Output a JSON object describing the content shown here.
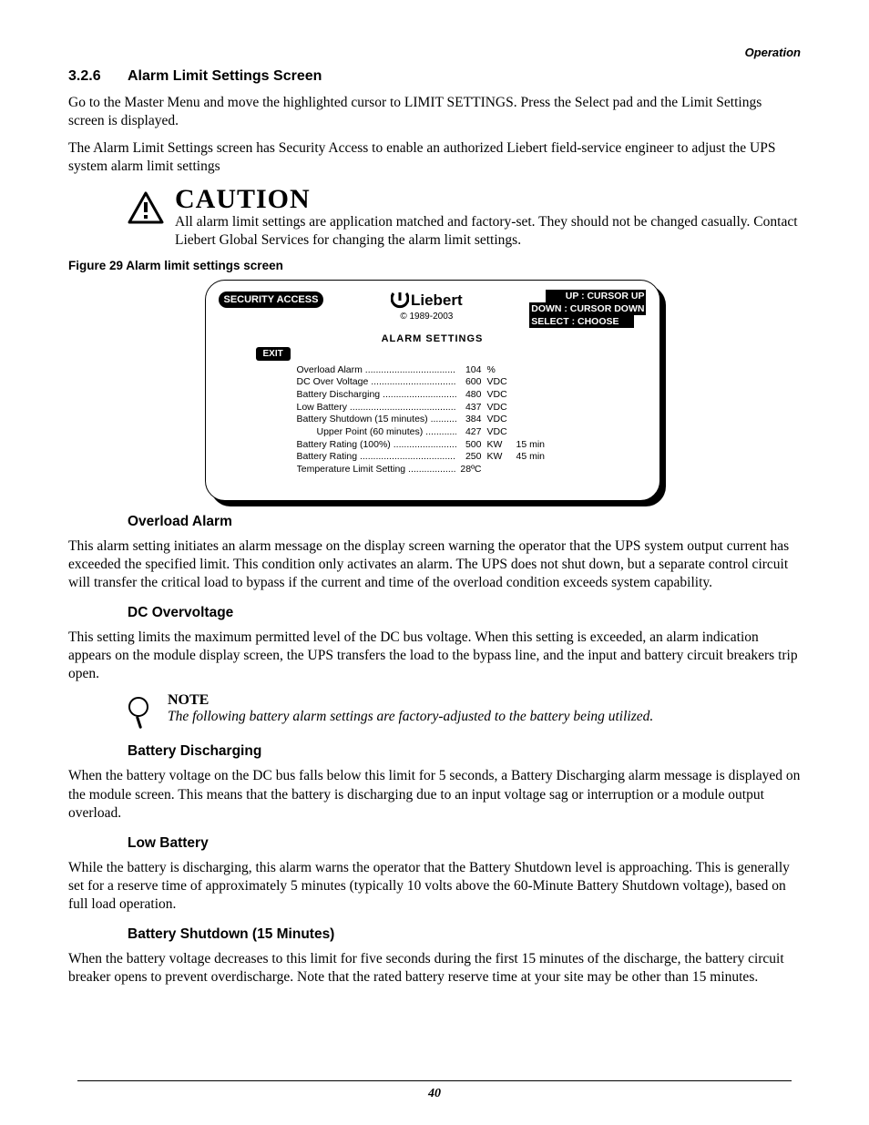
{
  "header": {
    "section": "Operation"
  },
  "section": {
    "number": "3.2.6",
    "title": "Alarm Limit Settings Screen",
    "para1": "Go to the Master Menu and move the highlighted cursor to LIMIT SETTINGS. Press the Select pad and the Limit Settings screen is displayed.",
    "para2": "The Alarm Limit Settings screen has Security Access to enable an authorized Liebert field-service engineer to adjust the UPS system alarm limit settings"
  },
  "caution": {
    "word": "CAUTION",
    "text": "All alarm limit settings are application matched and factory-set. They should not be changed casually. Contact Liebert Global Services for changing the alarm limit settings."
  },
  "figure": {
    "caption": "Figure 29  Alarm limit settings screen"
  },
  "screen": {
    "security_access": "SECURITY ACCESS",
    "brand": "Liebert",
    "copyright": "© 1989-2003",
    "cursor_up": "UP      : CURSOR UP",
    "cursor_down": "DOWN : CURSOR DOWN",
    "select": "SELECT : CHOOSE",
    "title": "ALARM  SETTINGS",
    "exit": "EXIT",
    "rows": [
      {
        "label": "Overload Alarm",
        "value": "104",
        "unit": "%",
        "extra": "",
        "indent": false
      },
      {
        "label": "DC Over Voltage",
        "value": "600",
        "unit": "VDC",
        "extra": "",
        "indent": false
      },
      {
        "label": "Battery Discharging",
        "value": "480",
        "unit": "VDC",
        "extra": "",
        "indent": false
      },
      {
        "label": "Low Battery",
        "value": "437",
        "unit": "VDC",
        "extra": "",
        "indent": false
      },
      {
        "label": "Battery Shutdown  (15 minutes)",
        "value": "384",
        "unit": "VDC",
        "extra": "",
        "indent": false
      },
      {
        "label": "Upper Point  (60 minutes)",
        "value": "427",
        "unit": "VDC",
        "extra": "",
        "indent": true
      },
      {
        "label": "Battery Rating (100%)",
        "value": "500",
        "unit": "KW",
        "extra": "15 min",
        "indent": false
      },
      {
        "label": "Battery Rating",
        "value": "250",
        "unit": "KW",
        "extra": "45 min",
        "indent": false
      },
      {
        "label": "Temperature Limit Setting",
        "value": "28ºC",
        "unit": "",
        "extra": "",
        "indent": false
      }
    ]
  },
  "overload": {
    "heading": "Overload Alarm",
    "text": "This alarm setting initiates an alarm message on the display screen warning the operator that the UPS system output current has exceeded the specified limit. This condition only activates an alarm. The UPS does not shut down, but a separate control circuit will transfer the critical load to bypass if the current and time of the overload condition exceeds system capability."
  },
  "dcov": {
    "heading": "DC Overvoltage",
    "text": "This setting limits the maximum permitted level of the DC bus voltage. When this setting is exceeded, an alarm indication appears on the module display screen, the UPS transfers the load to the bypass line, and the input and battery circuit breakers trip open."
  },
  "note": {
    "word": "NOTE",
    "text": "The following battery alarm settings are factory-adjusted to the battery being utilized."
  },
  "batt_disch": {
    "heading": "Battery Discharging",
    "text": "When the battery voltage on the DC bus falls below this limit for 5 seconds, a Battery Discharging alarm message is displayed on the module screen. This means that the battery is discharging due to an input voltage sag or interruption or a module output overload."
  },
  "low_batt": {
    "heading": "Low Battery",
    "text": "While the battery is discharging, this alarm warns the operator that the Battery Shutdown level is approaching. This is generally set for a reserve time of approximately 5 minutes (typically 10 volts above the 60-Minute Battery Shutdown voltage), based on full load operation."
  },
  "batt_shut": {
    "heading": "Battery Shutdown (15 Minutes)",
    "text": "When the battery voltage decreases to this limit for five seconds during the first 15 minutes of the discharge, the battery circuit breaker opens to prevent overdischarge. Note that the rated battery reserve time at your site may be other than 15 minutes."
  },
  "page_number": "40"
}
